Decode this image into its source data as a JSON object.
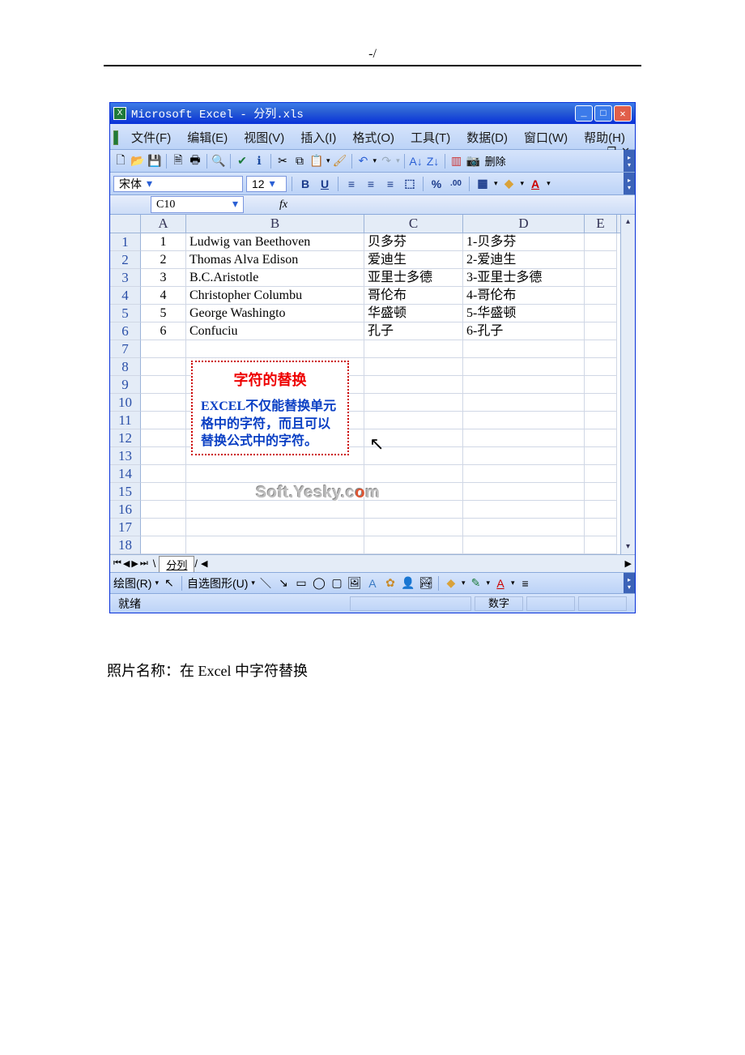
{
  "page": {
    "header_mark": "-/",
    "caption_prefix": "照片名称：",
    "caption_text": "在 Excel 中字符替换"
  },
  "window": {
    "title": "Microsoft Excel - 分列.xls"
  },
  "menu": {
    "file": "文件(F)",
    "edit": "编辑(E)",
    "view": "视图(V)",
    "insert": "插入(I)",
    "format": "格式(O)",
    "tools": "工具(T)",
    "data": "数据(D)",
    "window": "窗口(W)",
    "help": "帮助(H)"
  },
  "toolbar": {
    "delete": "删除"
  },
  "format_bar": {
    "font_name": "宋体",
    "font_size": "12"
  },
  "namebox": {
    "cell_ref": "C10",
    "fx": "fx"
  },
  "columns": {
    "A": "A",
    "B": "B",
    "C": "C",
    "D": "D",
    "E": "E"
  },
  "rows": [
    {
      "n": "1",
      "A": "1",
      "B": "Ludwig van Beethoven",
      "C": "贝多芬",
      "D": "1-贝多芬"
    },
    {
      "n": "2",
      "A": "2",
      "B": "Thomas Alva Edison",
      "C": "爱迪生",
      "D": "2-爱迪生"
    },
    {
      "n": "3",
      "A": "3",
      "B": "B.C.Aristotle",
      "C": "亚里士多德",
      "D": "3-亚里士多德"
    },
    {
      "n": "4",
      "A": "4",
      "B": "Christopher Columbu",
      "C": "哥伦布",
      "D": "4-哥伦布"
    },
    {
      "n": "5",
      "A": "5",
      "B": "George Washingto",
      "C": "华盛顿",
      "D": "5-华盛顿"
    },
    {
      "n": "6",
      "A": "6",
      "B": "Confuciu",
      "C": "孔子",
      "D": "6-孔子"
    },
    {
      "n": "7"
    },
    {
      "n": "8"
    },
    {
      "n": "9"
    },
    {
      "n": "10"
    },
    {
      "n": "11"
    },
    {
      "n": "12"
    },
    {
      "n": "13"
    },
    {
      "n": "14"
    },
    {
      "n": "15"
    },
    {
      "n": "16"
    },
    {
      "n": "17"
    },
    {
      "n": "18"
    }
  ],
  "callout": {
    "title": "字符的替换",
    "body": "EXCEL不仅能替换单元格中的字符，而且可以替换公式中的字符。"
  },
  "watermark": {
    "text_a": "Soft.Yesky.c",
    "text_b": "o",
    "text_c": "m"
  },
  "sheet": {
    "name": "分列"
  },
  "drawbar": {
    "draw": "绘图(R)",
    "autoshape": "自选图形(U)"
  },
  "status": {
    "ready": "就绪",
    "mode": "数字"
  }
}
